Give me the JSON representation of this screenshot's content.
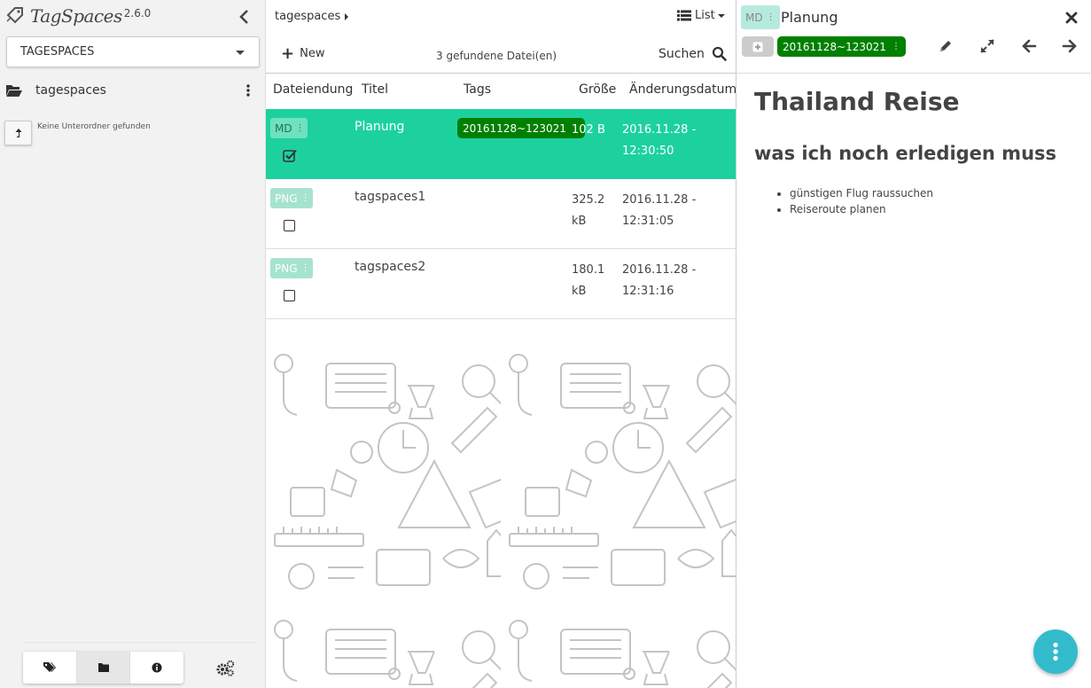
{
  "app": {
    "name": "TagSpaces",
    "version": "2.6.0"
  },
  "sidebar": {
    "location_select": "TAGESPACES",
    "current_dir": "tagespaces",
    "no_subfolders": "Keine Unterordner gefunden",
    "bottom_buttons": [
      "tags-icon",
      "folder-icon",
      "info-icon"
    ]
  },
  "filelist": {
    "breadcrumb": "tagespaces",
    "view_mode": "List",
    "new_label": "New",
    "count_text": "3 gefundene Datei(en)",
    "search_label": "Suchen",
    "columns": [
      "Dateiendung",
      "Titel",
      "Tags",
      "Größe",
      "Änderungsdatum"
    ],
    "rows": [
      {
        "ext": "MD",
        "title": "Planung",
        "tag": "20161128~123021",
        "size": "102 B",
        "date1": "2016.11.28 -",
        "date2": "12:30:50",
        "selected": true
      },
      {
        "ext": "PNG",
        "title": "tagspaces1",
        "tag": "",
        "size1": "325.2",
        "size2": "kB",
        "date1": "2016.11.28 -",
        "date2": "12:31:05",
        "selected": false
      },
      {
        "ext": "PNG",
        "title": "tagspaces2",
        "tag": "",
        "size1": "180.1",
        "size2": "kB",
        "date1": "2016.11.28 -",
        "date2": "12:31:16",
        "selected": false
      }
    ]
  },
  "viewer": {
    "ext": "MD",
    "title": "Planung",
    "tag": "20161128~123021",
    "doc": {
      "h1": "Thailand Reise",
      "h2": "was ich noch erledigen muss",
      "items": [
        "günstigen Flug raussuchen",
        "Reiseroute planen"
      ]
    }
  },
  "colors": {
    "selected_row": "#1dd19f",
    "tag_green": "#008000",
    "fab": "#33bbcc"
  }
}
